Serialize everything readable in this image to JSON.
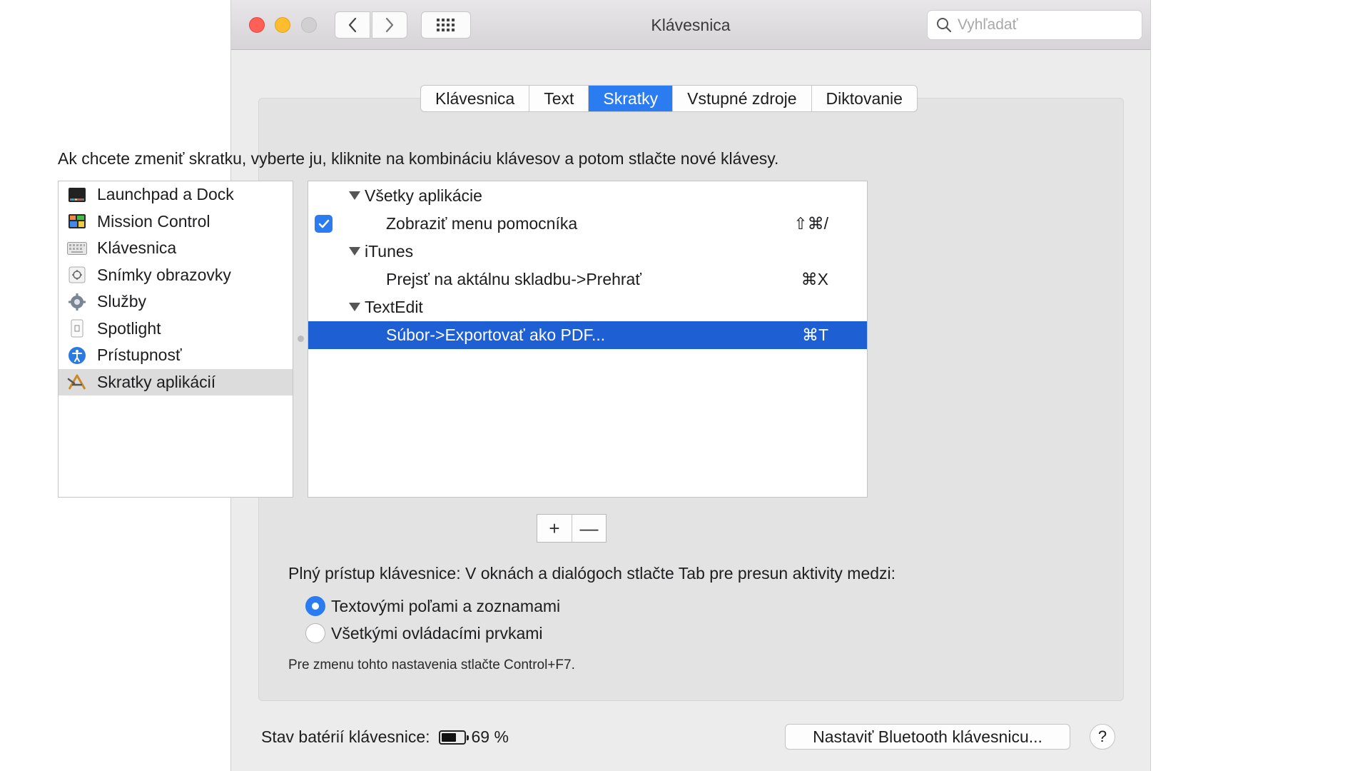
{
  "window": {
    "title": "Klávesnica",
    "search_placeholder": "Vyhľadať"
  },
  "tabs": [
    {
      "label": "Klávesnica",
      "active": false
    },
    {
      "label": "Text",
      "active": false
    },
    {
      "label": "Skratky",
      "active": true
    },
    {
      "label": "Vstupné zdroje",
      "active": false
    },
    {
      "label": "Diktovanie",
      "active": false
    }
  ],
  "instruction": "Ak chcete zmeniť skratku, vyberte ju, kliknite na kombináciu klávesov a potom stlačte nové klávesy.",
  "categories": [
    {
      "label": "Launchpad a Dock",
      "icon": "launchpad-icon"
    },
    {
      "label": "Mission Control",
      "icon": "mission-control-icon"
    },
    {
      "label": "Klávesnica",
      "icon": "keyboard-icon"
    },
    {
      "label": "Snímky obrazovky",
      "icon": "screenshot-icon"
    },
    {
      "label": "Služby",
      "icon": "gear-icon"
    },
    {
      "label": "Spotlight",
      "icon": "spotlight-icon"
    },
    {
      "label": "Prístupnosť",
      "icon": "accessibility-icon"
    },
    {
      "label": "Skratky aplikácií",
      "icon": "app-shortcuts-icon",
      "selected": true
    }
  ],
  "shortcuts": {
    "group_all": "Všetky aplikácie",
    "item_help": {
      "label": "Zobraziť menu pomocníka",
      "key": "⇧⌘/",
      "checked": true
    },
    "group_itunes": "iTunes",
    "item_itunes": {
      "label": "Prejsť na aktálnu skladbu->Prehrať",
      "key": "⌘X"
    },
    "group_textedit": "TextEdit",
    "item_textedit": {
      "label": "Súbor->Exportovať ako PDF...",
      "key": "⌘T",
      "selected": true
    }
  },
  "buttons": {
    "add": "+",
    "remove": "—",
    "bluetooth": "Nastaviť Bluetooth klávesnicu...",
    "help": "?"
  },
  "full_keyboard_access": {
    "title": "Plný prístup klávesnice: V oknách a dialógoch stlačte Tab pre presun aktivity medzi:",
    "option1": "Textovými poľami a zoznamami",
    "option2": "Všetkými ovládacími prvkami",
    "selected": "option1",
    "hint": "Pre zmenu tohto nastavenia stlačte Control+F7."
  },
  "battery": {
    "label": "Stav batérií klávesnice:",
    "percent_text": "69 %",
    "level": 0.69
  },
  "colors": {
    "accent": "#2b7bf1",
    "selection": "#1f5fd4"
  }
}
